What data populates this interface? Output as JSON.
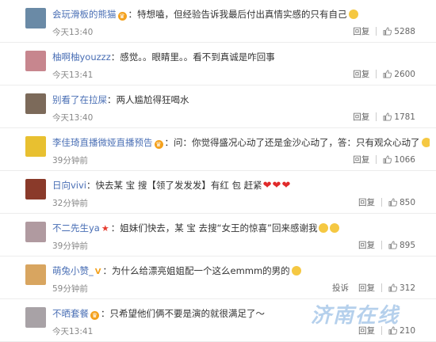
{
  "comments": [
    {
      "user": "会玩滑板的熊猫",
      "badge": "vip",
      "text": "：特想嗑，但经验告诉我最后付出真情实感的只有自己",
      "emoji": "face",
      "time": "今天13:40",
      "actions": [
        "回复"
      ],
      "likes": "5288",
      "avatar_color": "#6a8aa6"
    },
    {
      "user": "柚啊柚youzzz",
      "badge": "",
      "text": "：感觉。。眼睛里。。看不到真诚是咋回事",
      "emoji": "",
      "time": "今天13:41",
      "actions": [
        "回复"
      ],
      "likes": "2600",
      "avatar_color": "#c7868e"
    },
    {
      "user": "别看了在拉屎",
      "badge": "",
      "text": "：两人尴尬得狂喝水",
      "emoji": "",
      "time": "今天13:40",
      "actions": [
        "回复"
      ],
      "likes": "1781",
      "avatar_color": "#7c6a5a"
    },
    {
      "user": "李佳琦直播微娅直播预告",
      "badge": "vip",
      "text": "：问：你觉得盛况心动了还是金沙心动了，答：只有观众心动了",
      "emoji": "cat",
      "time": "39分钟前",
      "actions": [
        "回复"
      ],
      "likes": "1066",
      "avatar_color": "#e8c030"
    },
    {
      "user": "日向vivi",
      "badge": "",
      "text": "：快去某 宝 搜【领了发发发】有红 包 赶紧",
      "emoji": "hearts",
      "time": "32分钟前",
      "actions": [
        "回复"
      ],
      "likes": "850",
      "avatar_color": "#8a3a2a"
    },
    {
      "user": "不二先生ya",
      "badge": "star",
      "text": "：姐妹们快去，某 宝 去搜“女王的惊喜”回来感谢我",
      "emoji": "cats",
      "time": "39分钟前",
      "actions": [
        "回复"
      ],
      "likes": "895",
      "avatar_color": "#b09aa0"
    },
    {
      "user": "萌兔小赞_",
      "badge": "V",
      "text": "：为什么给漂亮姐姐配一个这么emmm的男的",
      "emoji": "face",
      "time": "59分钟前",
      "actions": [
        "投诉",
        "回复"
      ],
      "likes": "312",
      "avatar_color": "#d8a560"
    },
    {
      "user": "不晒套餐",
      "badge": "vip",
      "text": "：只希望他们俩不要是演的就很满足了～",
      "emoji": "",
      "time": "今天13:41",
      "actions": [
        "回复"
      ],
      "likes": "210",
      "avatar_color": "#a8a2a6"
    }
  ],
  "watermark": "济南在线"
}
